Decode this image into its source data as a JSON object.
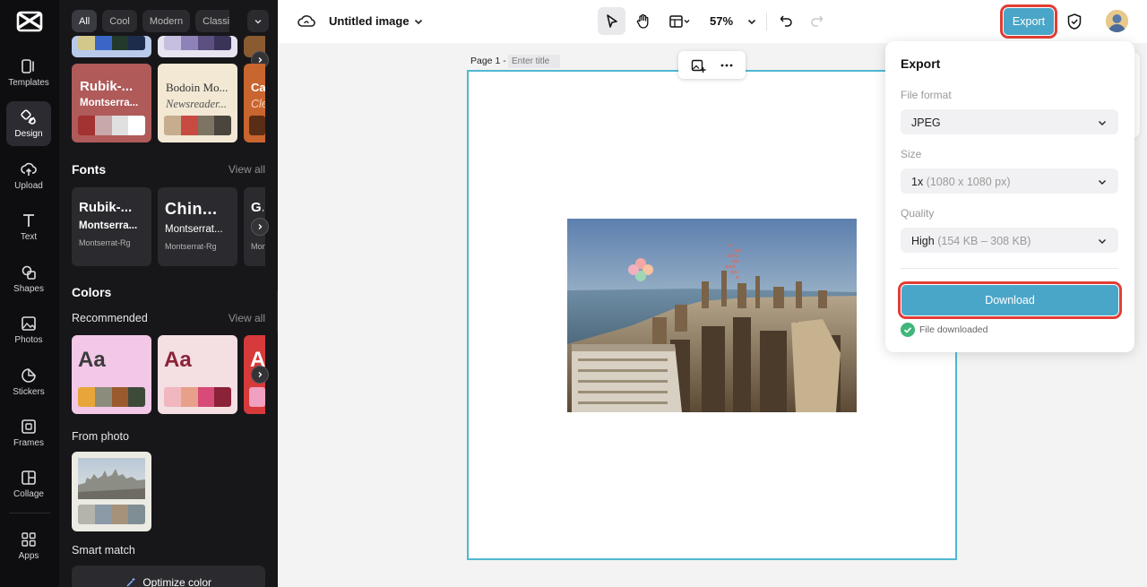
{
  "rail": {
    "items": [
      {
        "label": "Templates",
        "icon": "templates-icon"
      },
      {
        "label": "Design",
        "icon": "design-icon"
      },
      {
        "label": "Upload",
        "icon": "upload-icon"
      },
      {
        "label": "Text",
        "icon": "text-icon"
      },
      {
        "label": "Shapes",
        "icon": "shapes-icon"
      },
      {
        "label": "Photos",
        "icon": "photos-icon"
      },
      {
        "label": "Stickers",
        "icon": "stickers-icon"
      },
      {
        "label": "Frames",
        "icon": "frames-icon"
      },
      {
        "label": "Collage",
        "icon": "collage-icon"
      },
      {
        "label": "Apps",
        "icon": "apps-icon"
      }
    ],
    "active": "Design"
  },
  "panel": {
    "chips": [
      "All",
      "Cool",
      "Modern",
      "Classic"
    ],
    "styles": [
      {
        "font": "Rubik-...",
        "sub": "Montserra...",
        "colors": [
          "#a33232",
          "#c8a8a8",
          "#e0e0e0",
          "#ffffff"
        ]
      },
      {
        "font": "Bodoin Mo...",
        "sub": "Newsreader...",
        "colors": [
          "#c7ad8e",
          "#c74a43",
          "#7e7463",
          "#4a463e"
        ]
      },
      {
        "font": "Ca",
        "sub": "Cle",
        "colors": [
          "#5a2d17"
        ]
      }
    ],
    "fonts": {
      "title": "Fonts",
      "view_all": "View all",
      "items": [
        {
          "a": "Rubik-...",
          "b": "Montserra...",
          "c": "Montserrat-Rg"
        },
        {
          "a": "Chin...",
          "b": "Montserrat...",
          "c": "Montserrat-Rg"
        },
        {
          "a": "Gu",
          "b": "",
          "c": "Mon"
        }
      ]
    },
    "colors": {
      "title": "Colors",
      "recommended": "Recommended",
      "view_all": "View all",
      "cards": [
        {
          "label": "Aa",
          "bg": "#f2c7e8",
          "fg": "#3b3b3b",
          "sw": [
            "#e8a63a",
            "#8c8c7c",
            "#9a5a2e",
            "#3d4a3a"
          ]
        },
        {
          "label": "Aa",
          "bg": "#f4dfe3",
          "fg": "#8a2238",
          "sw": [
            "#f0b8be",
            "#e8a08a",
            "#d84a78",
            "#8a2238"
          ]
        },
        {
          "label": "A",
          "bg": "#d63a3a",
          "fg": "#ffffff",
          "sw": [
            "#f0a0c0"
          ]
        }
      ],
      "from_photo": "From photo",
      "photo_swatch": [
        "#b4b4ac",
        "#8c9aa8",
        "#a6927a",
        "#7e8e94"
      ],
      "smart_match": "Smart match",
      "optimize": "Optimize color"
    }
  },
  "topbar": {
    "title": "Untitled image",
    "zoom": "57%",
    "export_label": "Export"
  },
  "canvas": {
    "page_label": "Page 1 -",
    "title_placeholder": "Enter title"
  },
  "export_panel": {
    "title": "Export",
    "file_format_label": "File format",
    "file_format_value": "JPEG",
    "size_label": "Size",
    "size_value": "1x",
    "size_detail": "(1080 x 1080 px)",
    "quality_label": "Quality",
    "quality_value": "High",
    "quality_detail": "(154 KB – 308 KB)",
    "download_label": "Download",
    "status": "File downloaded"
  }
}
